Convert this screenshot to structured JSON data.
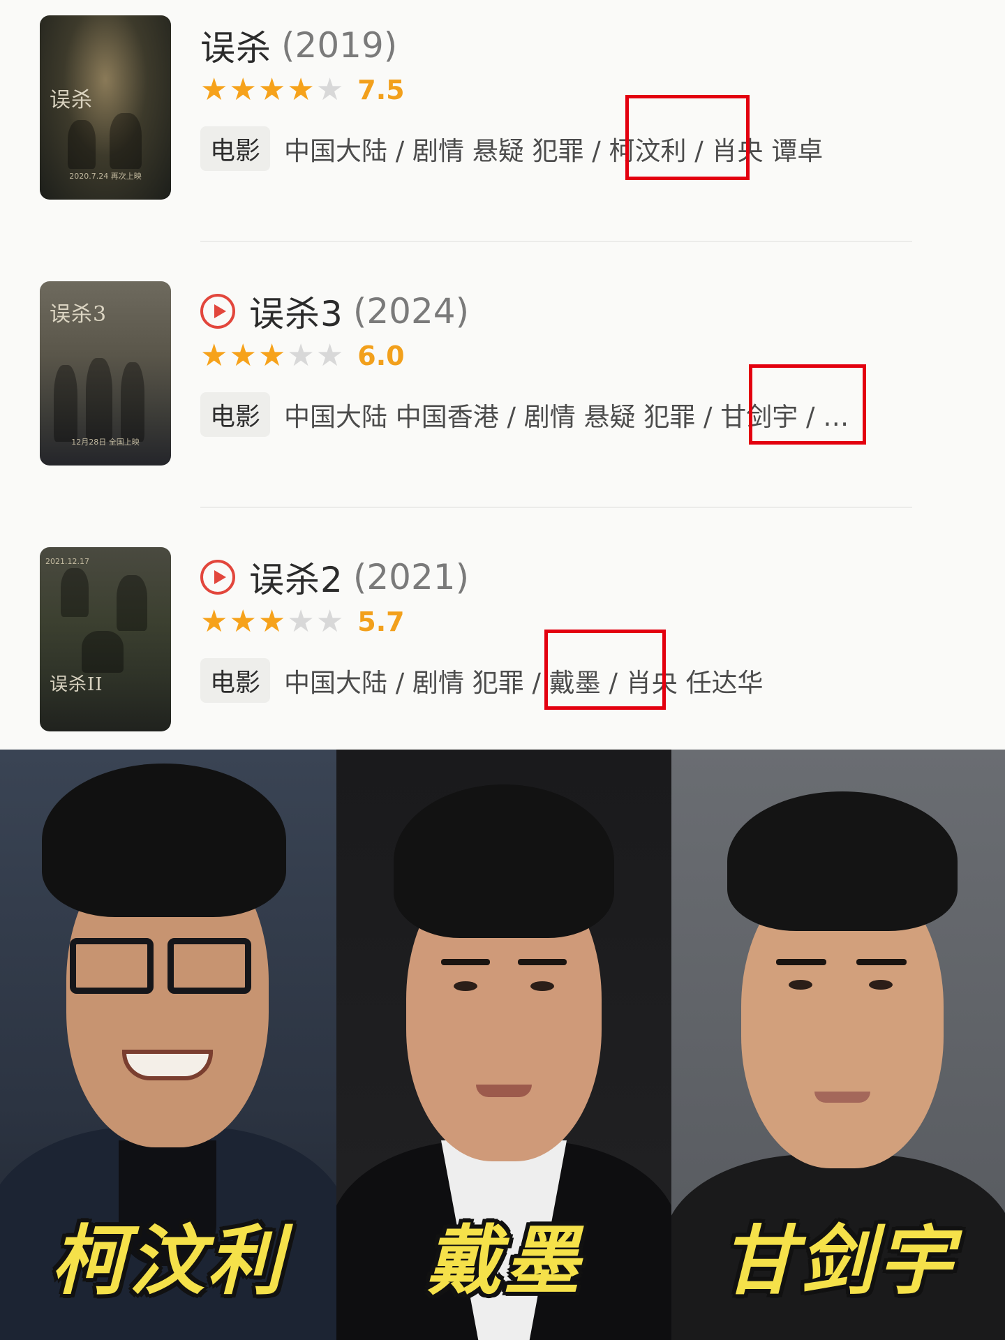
{
  "movies": [
    {
      "title": "误杀",
      "year": "(2019)",
      "has_play": false,
      "rating": 7.5,
      "stars": [
        "full",
        "full",
        "full",
        "full",
        "empty"
      ],
      "score": "7.5",
      "tag": "电影",
      "info": "中国大陆 / 剧情 悬疑 犯罪 / 柯汶利 / 肖央 谭卓",
      "poster": {
        "title": "误杀",
        "caption": "2020.7.24 再次上映"
      },
      "highlighted_name": "柯汶利"
    },
    {
      "title": "误杀3",
      "year": "(2024)",
      "has_play": true,
      "rating": 6.0,
      "stars": [
        "full",
        "full",
        "full",
        "empty",
        "empty"
      ],
      "score": "6.0",
      "tag": "电影",
      "info": "中国大陆 中国香港 / 剧情 悬疑 犯罪 / 甘剑宇 / …",
      "poster": {
        "title": "误杀3",
        "caption": "12月28日 全国上映"
      },
      "highlighted_name": "甘剑宇"
    },
    {
      "title": "误杀2",
      "year": "(2021)",
      "has_play": true,
      "rating": 5.7,
      "stars": [
        "full",
        "full",
        "full",
        "empty",
        "empty"
      ],
      "score": "5.7",
      "tag": "电影",
      "info": "中国大陆 / 剧情 犯罪 / 戴墨 / 肖央 任达华",
      "poster": {
        "title": "误杀II",
        "caption": "2021.12.17"
      },
      "highlighted_name": "戴墨"
    }
  ],
  "portraits": [
    {
      "name": "柯汶利"
    },
    {
      "name": "戴墨"
    },
    {
      "name": "甘剑宇"
    }
  ],
  "colors": {
    "star": "#f6a21b",
    "score": "#f2a01c",
    "play": "#e2463c",
    "highlight_box": "#e3000f",
    "caption": "#f5e14a"
  }
}
